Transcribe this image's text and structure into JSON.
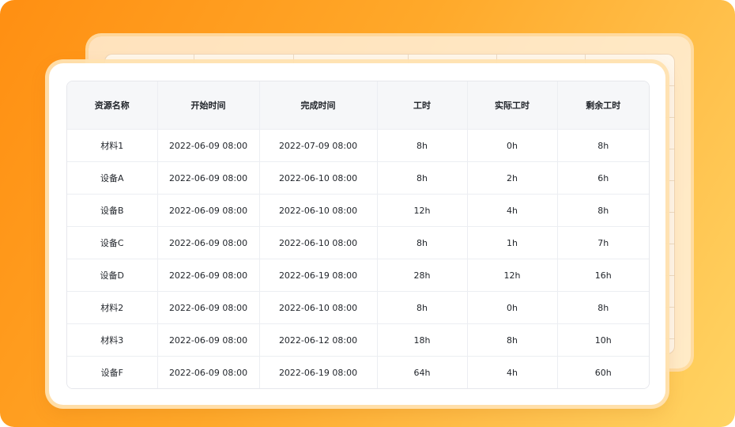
{
  "table": {
    "columns": [
      "资源名称",
      "开始时间",
      "完成时间",
      "工时",
      "实际工时",
      "剩余工时"
    ],
    "rows": [
      [
        "材料1",
        "2022-06-09 08:00",
        "2022-07-09 08:00",
        "8h",
        "0h",
        "8h"
      ],
      [
        "设备A",
        "2022-06-09 08:00",
        "2022-06-10 08:00",
        "8h",
        "2h",
        "6h"
      ],
      [
        "设备B",
        "2022-06-09 08:00",
        "2022-06-10 08:00",
        "12h",
        "4h",
        "8h"
      ],
      [
        "设备C",
        "2022-06-09 08:00",
        "2022-06-10 08:00",
        "8h",
        "1h",
        "7h"
      ],
      [
        "设备D",
        "2022-06-09 08:00",
        "2022-06-19 08:00",
        "28h",
        "12h",
        "16h"
      ],
      [
        "材料2",
        "2022-06-09 08:00",
        "2022-06-10 08:00",
        "8h",
        "0h",
        "8h"
      ],
      [
        "材料3",
        "2022-06-09 08:00",
        "2022-06-12 08:00",
        "18h",
        "8h",
        "10h"
      ],
      [
        "设备F",
        "2022-06-09 08:00",
        "2022-06-19 08:00",
        "64h",
        "4h",
        "60h"
      ]
    ]
  },
  "colors": {
    "background_start": "#ff8f12",
    "background_end": "#ffd463",
    "card": "#ffffff",
    "header_bg": "#f6f7f9",
    "text": "#1f2329"
  }
}
